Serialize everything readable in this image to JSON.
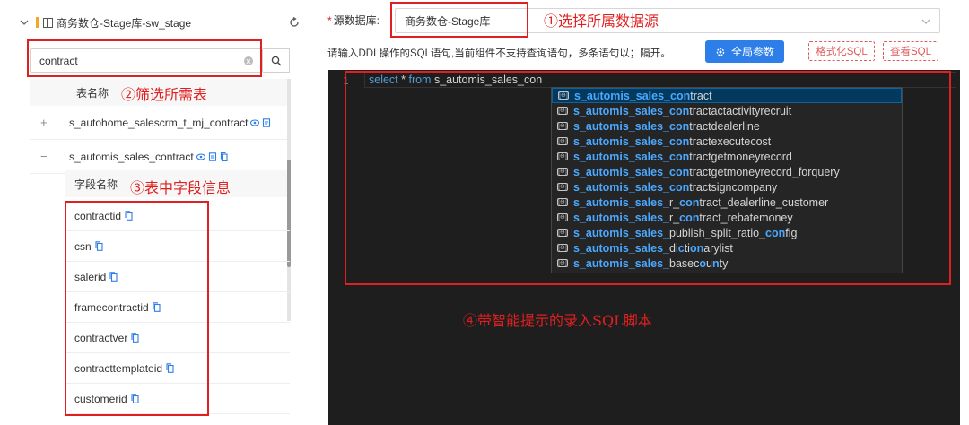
{
  "left_panel": {
    "datasource_title": "商务数仓-Stage库-sw_stage",
    "search_value": "contract",
    "table_column_header": "表名称",
    "tables": [
      {
        "toggle": "+",
        "name": "s_autohome_salescrm_t_mj_contract"
      },
      {
        "toggle": "−",
        "name": "s_automis_sales_contract"
      }
    ],
    "field_column_header": "字段名称",
    "fields": [
      "contractid",
      "csn",
      "salerid",
      "framecontractid",
      "contractver",
      "contracttemplateid",
      "customerid"
    ]
  },
  "annotations": {
    "a1": "①选择所属数据源",
    "a2": "②筛选所需表",
    "a3": "③表中字段信息",
    "a4": "④带智能提示的录入SQL脚本"
  },
  "right_panel": {
    "source_label": "源数据库:",
    "source_required_mark": "*",
    "source_value": "商务数仓-Stage库",
    "hint_text": "请输入DDL操作的SQL语句,当前组件不支持查询语句，多条语句以；隔开。",
    "global_params_label": "全局参数",
    "format_sql_label": "格式化SQL",
    "view_sql_label": "查看SQL"
  },
  "editor": {
    "line_number": "1",
    "code_keyword_1": "select",
    "code_star": " * ",
    "code_keyword_2": "from",
    "code_rest": " s_automis_sales_con",
    "suggestion_kind_icon": "[⊖]",
    "suggestions": [
      {
        "hl": "s_automis_sales_con",
        "rest": "tract",
        "selected": true
      },
      {
        "hl": "s_automis_sales_con",
        "rest": "tractactactivityrecruit"
      },
      {
        "hl": "s_automis_sales_con",
        "rest": "tractdealerline"
      },
      {
        "hl": "s_automis_sales_con",
        "rest": "tractexecutecost"
      },
      {
        "hl": "s_automis_sales_con",
        "rest": "tractgetmoneyrecord"
      },
      {
        "hl": "s_automis_sales_con",
        "rest": "tractgetmoneyrecord_forquery"
      },
      {
        "hl": "s_automis_sales_con",
        "rest": "tractsigncompany"
      },
      {
        "parts": [
          [
            "s_automis_sales_",
            1
          ],
          [
            "r_",
            0
          ],
          [
            "con",
            1
          ],
          [
            "tract_dealerline_customer",
            0
          ]
        ]
      },
      {
        "parts": [
          [
            "s_automis_sales_",
            1
          ],
          [
            "r_",
            0
          ],
          [
            "con",
            1
          ],
          [
            "tract_rebatemoney",
            0
          ]
        ]
      },
      {
        "parts": [
          [
            "s_automis_sales_",
            1
          ],
          [
            "publish_split_ratio_",
            0
          ],
          [
            "con",
            1
          ],
          [
            "fig",
            0
          ]
        ]
      },
      {
        "parts": [
          [
            "s_automis_sales_",
            1
          ],
          [
            "di",
            0
          ],
          [
            "c",
            1
          ],
          [
            "ti",
            0
          ],
          [
            "on",
            1
          ],
          [
            "arylist",
            0
          ]
        ]
      },
      {
        "parts": [
          [
            "s_automis_sales_",
            1
          ],
          [
            "basec",
            0
          ],
          [
            "o",
            1
          ],
          [
            "u",
            0
          ],
          [
            "n",
            1
          ],
          [
            "ty",
            0
          ]
        ]
      }
    ]
  },
  "colors": {
    "annotation_red": "#e02020",
    "primary_blue": "#2d7ee8",
    "editor_bg": "#1e1e1e",
    "suggest_bg": "#252526",
    "match_highlight": "#4aa8ff"
  }
}
